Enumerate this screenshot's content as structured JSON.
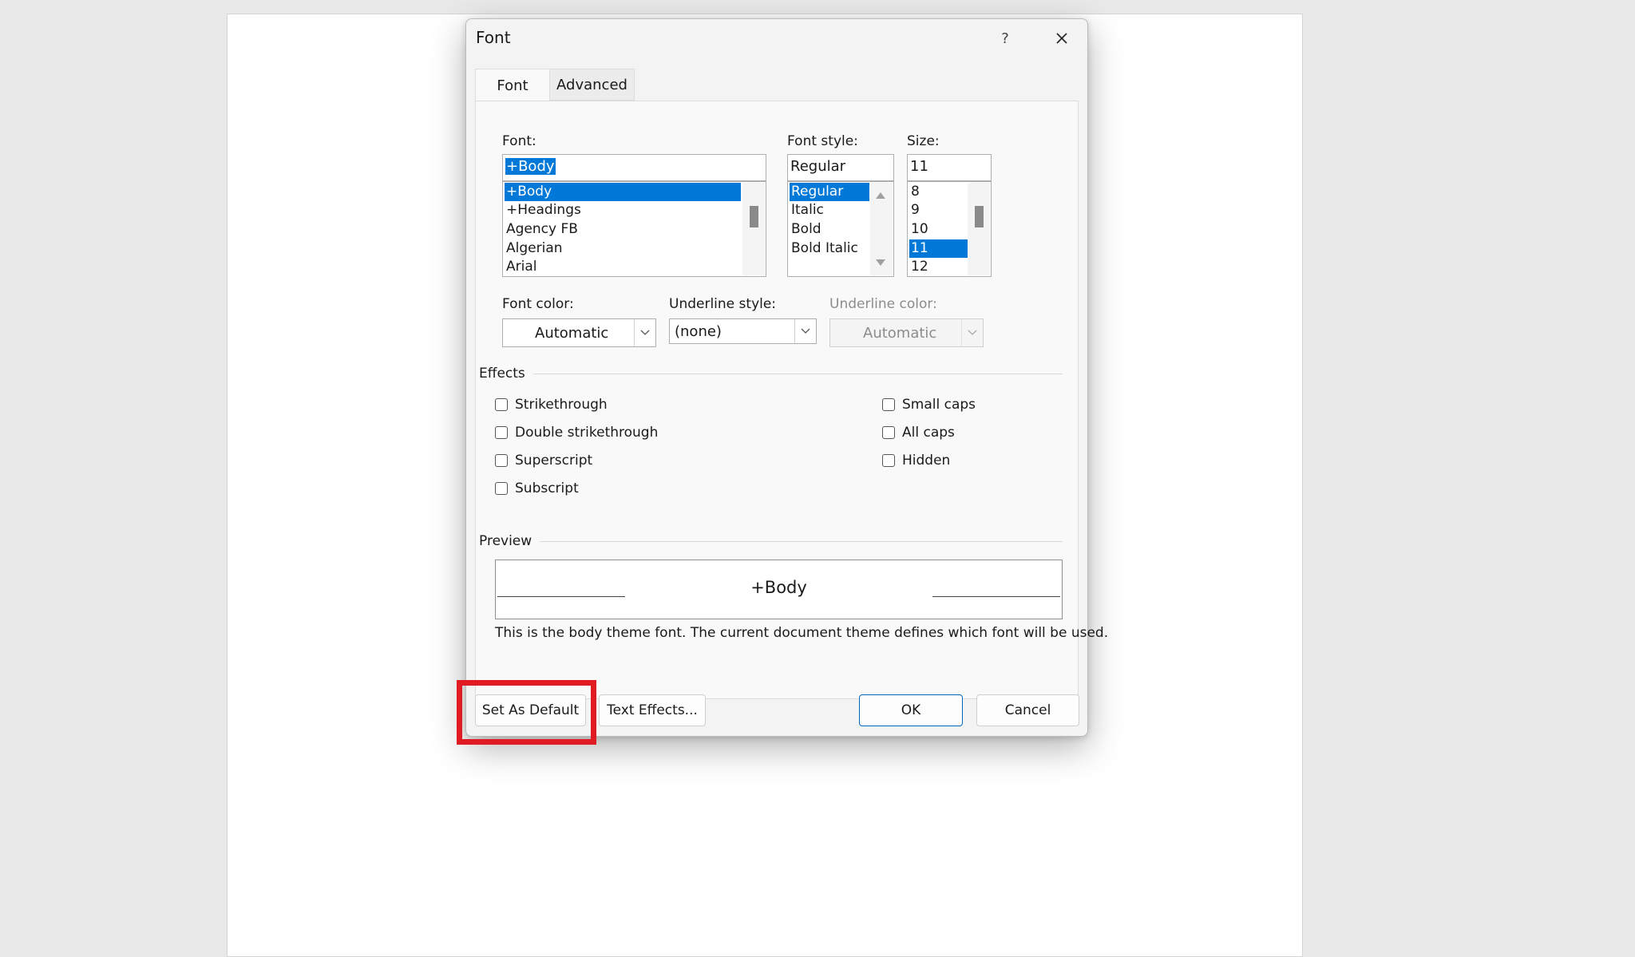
{
  "dialog": {
    "title": "Font",
    "help_label": "?",
    "tabs": [
      {
        "label": "Font",
        "active": true
      },
      {
        "label": "Advanced",
        "active": false
      }
    ]
  },
  "font": {
    "label": "Font:",
    "value": "+Body",
    "items": [
      "+Body",
      "+Headings",
      "Agency FB",
      "Algerian",
      "Arial"
    ],
    "selected_index": 0
  },
  "font_style": {
    "label": "Font style:",
    "value": "Regular",
    "items": [
      "Regular",
      "Italic",
      "Bold",
      "Bold Italic"
    ],
    "selected_index": 0
  },
  "size": {
    "label": "Size:",
    "value": "11",
    "items": [
      "8",
      "9",
      "10",
      "11",
      "12"
    ],
    "selected_index": 3
  },
  "font_color": {
    "label": "Font color:",
    "value": "Automatic"
  },
  "underline_style": {
    "label": "Underline style:",
    "value": "(none)"
  },
  "underline_color": {
    "label": "Underline color:",
    "value": "Automatic",
    "disabled": true
  },
  "effects": {
    "label": "Effects",
    "left": [
      "Strikethrough",
      "Double strikethrough",
      "Superscript",
      "Subscript"
    ],
    "right": [
      "Small caps",
      "All caps",
      "Hidden"
    ]
  },
  "preview": {
    "label": "Preview",
    "sample": "+Body",
    "note": "This is the body theme font. The current document theme defines which font will be used."
  },
  "buttons": {
    "set_default": "Set As Default",
    "text_effects": "Text Effects...",
    "ok": "OK",
    "cancel": "Cancel"
  },
  "colors": {
    "selection": "#0078d7",
    "highlight_box": "#e11b22",
    "primary_border": "#0067c0"
  }
}
